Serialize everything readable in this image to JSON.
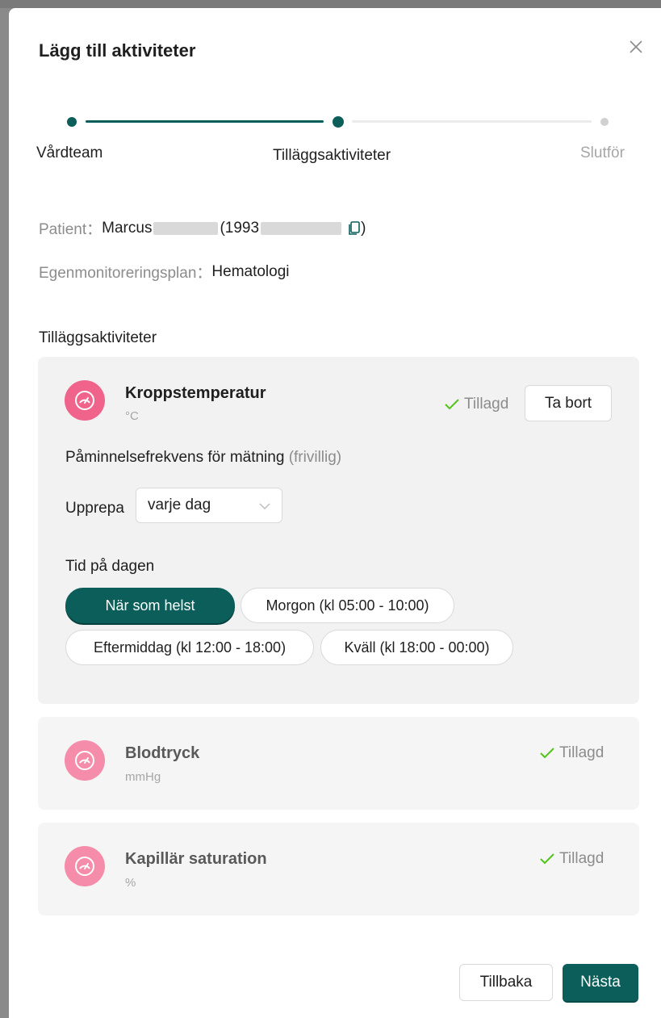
{
  "modal": {
    "title": "Lägg till aktiviteter"
  },
  "stepper": {
    "steps": [
      {
        "label": "Vårdteam",
        "state": "done"
      },
      {
        "label": "Tilläggsaktiviteter",
        "state": "current"
      },
      {
        "label": "Slutför",
        "state": "pending"
      }
    ]
  },
  "patient": {
    "label": "Patient：",
    "first_name": "Marcus",
    "id_prefix": "(1993",
    "id_suffix": ")"
  },
  "plan": {
    "label": "Egenmonitoreringsplan：",
    "value": "Hematologi"
  },
  "section_title": "Tilläggsaktiviteter",
  "activities": [
    {
      "name": "Kroppstemperatur",
      "unit": "°C",
      "status": "Tillagd",
      "remove_label": "Ta bort",
      "reminder_title": "Påminnelsefrekvens för mätning",
      "reminder_optional": "(frivillig)",
      "repeat_label": "Upprepa",
      "repeat_value": "varje dag",
      "time_label": "Tid på dagen",
      "time_options": [
        "När som helst",
        "Morgon (kl 05:00 - 10:00)",
        "Eftermiddag (kl 12:00 - 18:00)",
        "Kväll (kl 18:00 - 00:00)"
      ],
      "selected_time": "När som helst"
    },
    {
      "name": "Blodtryck",
      "unit": "mmHg",
      "status": "Tillagd"
    },
    {
      "name": "Kapillär saturation",
      "unit": "%",
      "status": "Tillagd"
    }
  ],
  "footer": {
    "back_label": "Tillbaka",
    "next_label": "Nästa"
  },
  "colors": {
    "primary": "#0b5e5a",
    "success": "#52c41a",
    "icon_pink": "#f0648c",
    "icon_pink_light": "#f58caa"
  }
}
